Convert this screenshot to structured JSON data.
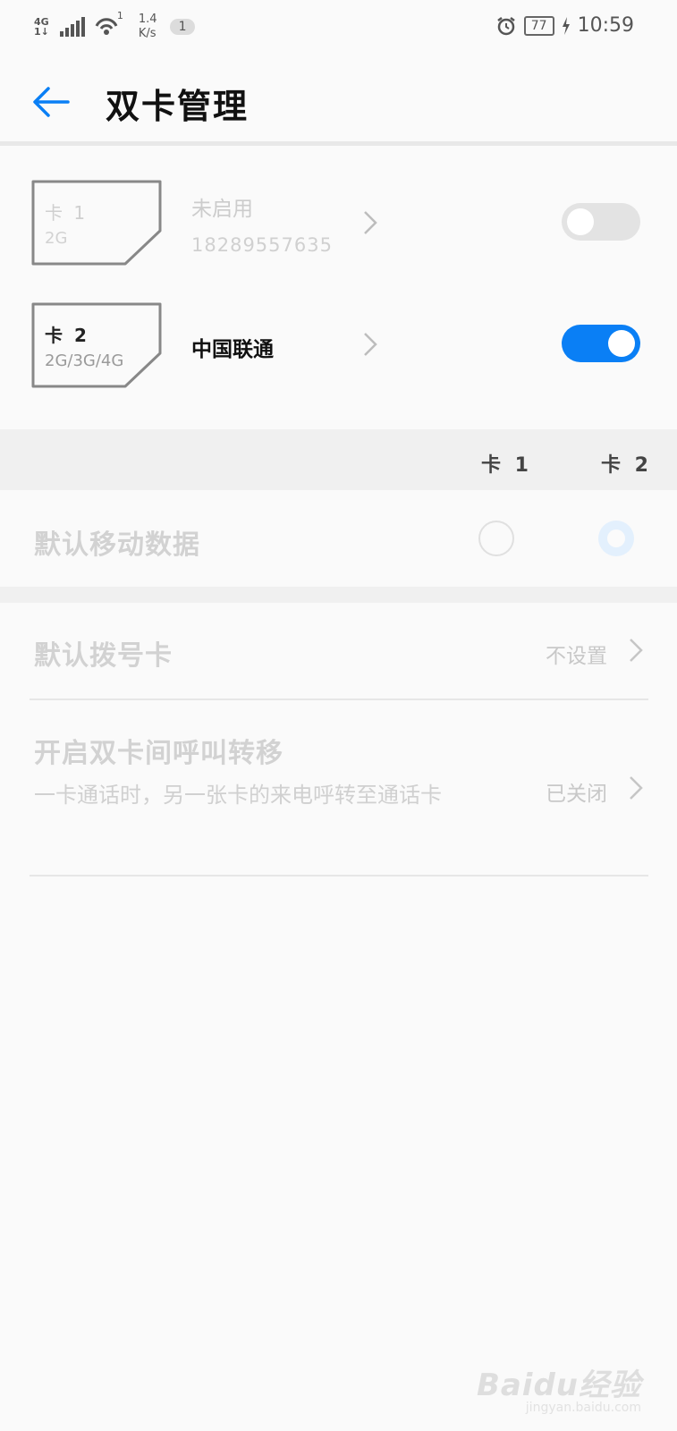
{
  "status_bar": {
    "network_type": "4G",
    "network_sub": "1↓",
    "wifi_index": "1",
    "speed_value": "1.4",
    "speed_unit": "K/s",
    "sim_indicator": "1",
    "battery": "77",
    "time": "10:59"
  },
  "header": {
    "title": "双卡管理",
    "back_icon": "arrow-left-icon"
  },
  "sim_cards": [
    {
      "name": "卡 1",
      "types": "2G",
      "status": "未启用",
      "number": "18289557635",
      "enabled": false
    },
    {
      "name": "卡 2",
      "types": "2G/3G/4G",
      "status": "中国联通",
      "number": "",
      "enabled": true
    }
  ],
  "columns": {
    "card1": "卡 1",
    "card2": "卡 2"
  },
  "mobile_data": {
    "label": "默认移动数据",
    "selected": "card2"
  },
  "settings": {
    "default_dial": {
      "label": "默认拨号卡",
      "value": "不设置"
    },
    "call_forward": {
      "label": "开启双卡间呼叫转移",
      "description": "一卡通话时，另一张卡的来电呼转至通话卡",
      "value": "已关闭"
    }
  },
  "watermark": {
    "logo": "Baidu经验",
    "url": "jingyan.baidu.com"
  },
  "colors": {
    "accent": "#0a7ff5",
    "disabled_text": "#c8c8c8",
    "toggle_off": "#e3e3e3"
  }
}
